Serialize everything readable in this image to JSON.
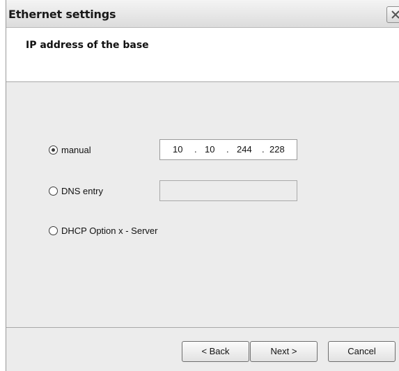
{
  "window": {
    "title": "Ethernet settings"
  },
  "header": {
    "title": "IP address of the base"
  },
  "options": {
    "manual_label": "manual",
    "dns_label": "DNS entry",
    "dhcp_label": "DHCP Option x - Server",
    "selected": "manual"
  },
  "ip": {
    "octets": [
      "10",
      "10",
      "244",
      "228"
    ],
    "separator": "."
  },
  "dns": {
    "value": ""
  },
  "buttons": {
    "back": "< Back",
    "next": "Next >",
    "cancel": "Cancel"
  },
  "icons": {
    "close": "close-icon"
  }
}
